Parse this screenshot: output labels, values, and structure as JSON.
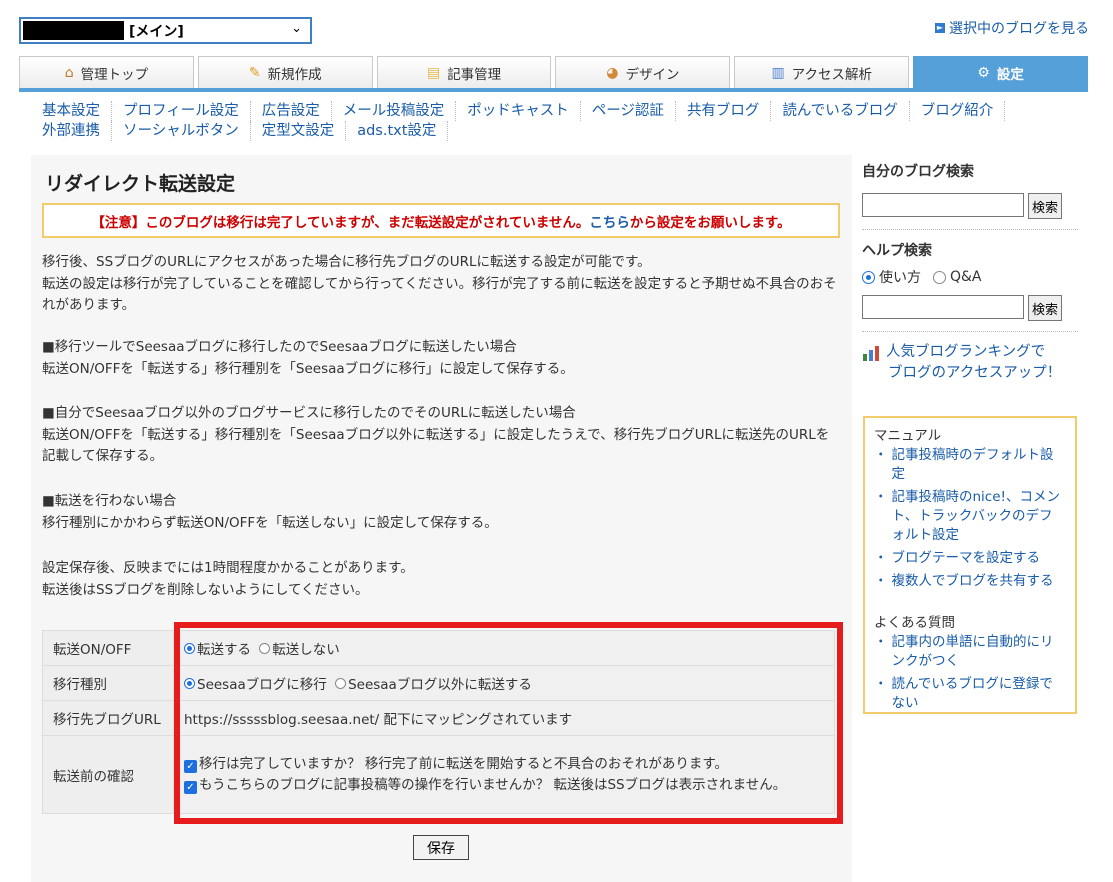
{
  "header": {
    "blog_selector_text": "[メイン]",
    "view_blog_link": "選択中のブログを見る"
  },
  "tabs": [
    {
      "label": "管理トップ",
      "icon": "home-icon"
    },
    {
      "label": "新規作成",
      "icon": "pencil-icon"
    },
    {
      "label": "記事管理",
      "icon": "folder-icon"
    },
    {
      "label": "デザイン",
      "icon": "palette-icon"
    },
    {
      "label": "アクセス解析",
      "icon": "bar-chart-icon"
    },
    {
      "label": "設定",
      "icon": "gear-icon",
      "active": true
    }
  ],
  "subnav": {
    "row1": [
      "基本設定",
      "プロフィール設定",
      "広告設定",
      "メール投稿設定",
      "ポッドキャスト",
      "ページ認証",
      "共有ブログ",
      "読んでいるブログ",
      "ブログ紹介"
    ],
    "row2": [
      "外部連携",
      "ソーシャルボタン",
      "定型文設定",
      "ads.txt設定"
    ]
  },
  "main": {
    "title": "リダイレクト転送設定",
    "notice_prefix": "【注意】このブログは移行は完了していますが、まだ転送設定がされていません。",
    "notice_link": "こちら",
    "notice_suffix": "から設定をお願いします。",
    "intro_1": "移行後、SSブログのURLにアクセスがあった場合に移行先ブログのURLに転送する設定が可能です。",
    "intro_2": "転送の設定は移行が完了していることを確認してから行ってください。移行が完了する前に転送を設定すると予期せぬ不具合のおそれがあります。",
    "case1_title": "■移行ツールでSeesaaブログに移行したのでSeesaaブログに転送したい場合",
    "case1_body": "転送ON/OFFを「転送する」移行種別を「Seesaaブログに移行」に設定して保存する。",
    "case2_title": "■自分でSeesaaブログ以外のブログサービスに移行したのでそのURLに転送したい場合",
    "case2_body": "転送ON/OFFを「転送する」移行種別を「Seesaaブログ以外に転送する」に設定したうえで、移行先ブログURLに転送先のURLを記載して保存する。",
    "case3_title": "■転送を行わない場合",
    "case3_body": "移行種別にかかわらず転送ON/OFFを「転送しない」に設定して保存する。",
    "note_1": "設定保存後、反映までには1時間程度かかることがあります。",
    "note_2": "転送後はSSブログを削除しないようにしてください。"
  },
  "settings": {
    "onoff_label": "転送ON/OFF",
    "onoff_on": "転送する",
    "onoff_off": "転送しない",
    "type_label": "移行種別",
    "type_seesaa": "Seesaaブログに移行",
    "type_other": "Seesaaブログ以外に転送する",
    "dest_label": "移行先ブログURL",
    "dest_value": "https://sssssblog.seesaa.net/ 配下にマッピングされています",
    "confirm_label": "転送前の確認",
    "confirm_1": "移行は完了していますか？ 移行完了前に転送を開始すると不具合のおそれがあります。",
    "confirm_2": "もうこちらのブログに記事投稿等の操作を行いませんか？ 転送後はSSブログは表示されません。",
    "save_label": "保存"
  },
  "sidebar": {
    "own_search_title": "自分のブログ検索",
    "search_button": "検索",
    "help_search_title": "ヘルプ検索",
    "help_opt_usage": "使い方",
    "help_opt_qa": "Q&A",
    "help_search_button": "検索",
    "ranking_line1": "人気ブログランキングで",
    "ranking_line2": "ブログのアクセスアップ！",
    "manual_caption": "マニュアル",
    "manual_links": [
      "記事投稿時のデフォルト設定",
      "記事投稿時のnice!、コメント、トラックバックのデフォルト設定",
      "ブログテーマを設定する",
      "複数人でブログを共有する"
    ],
    "faq_caption": "よくある質問",
    "faq_links": [
      "記事内の単語に自動的にリンクがつく",
      "読んでいるブログに登録でない"
    ]
  },
  "colors": {
    "accent_blue": "#55a0d9",
    "link_blue": "#1a5ca8",
    "warning_red": "#cc0000",
    "highlight_red": "#e61c1c",
    "notice_border": "#f1cc6b"
  }
}
